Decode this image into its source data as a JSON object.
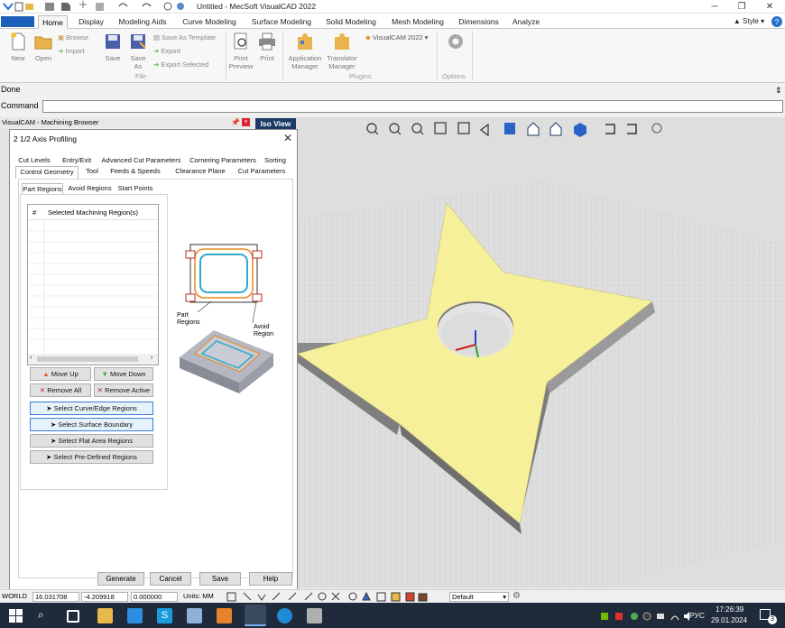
{
  "window": {
    "title": "Untitled - MecSoft VisualCAD 2022"
  },
  "ribbon_tabs": [
    "Home",
    "Display",
    "Modeling Aids",
    "Curve Modeling",
    "Surface Modeling",
    "Solid Modeling",
    "Mesh Modeling",
    "Dimensions",
    "Analyze"
  ],
  "style_label": "Style",
  "ribbon": {
    "new": "New",
    "open": "Open",
    "browse": "Browse",
    "import": "Import",
    "save": "Save",
    "save_as_1": "Save",
    "save_as_2": "As",
    "save_as_template": "Save As Template",
    "export": "Export",
    "export_selected": "Export Selected",
    "file_group": "File",
    "print_preview_1": "Print",
    "print_preview_2": "Preview",
    "print": "Print",
    "app_manager_1": "Application",
    "app_manager_2": "Manager",
    "translator_manager_1": "Translator",
    "translator_manager_2": "Manager",
    "visualcam": "VisualCAM 2022",
    "plugins_group": "Plugins",
    "options_group": "Options"
  },
  "status": {
    "message": "Done",
    "command_label": "Command"
  },
  "browser": {
    "title": "VisualCAM - Machining Browser"
  },
  "viewport": {
    "label": "Iso View"
  },
  "dialog": {
    "title": "2 1/2 Axis Profiling",
    "tabs_row1": [
      "Cut Levels",
      "Entry/Exit",
      "Advanced Cut Parameters",
      "Cornering Parameters",
      "Sorting"
    ],
    "tabs_row2": [
      "Control Geometry",
      "Tool",
      "Feeds & Speeds",
      "Clearance Plane",
      "Cut Parameters"
    ],
    "subtabs": [
      "Part Regions",
      "Avoid Regions",
      "Start Points"
    ],
    "list_headers": [
      "#",
      "Selected Machining Region(s)"
    ],
    "buttons": {
      "move_up": "Move Up",
      "move_down": "Move Down",
      "remove_all": "Remove All",
      "remove_active": "Remove Active",
      "select_curve": "Select Curve/Edge Regions",
      "select_surface": "Select Surface Boundary",
      "select_flat": "Select Flat Area Regions",
      "select_predefined": "Select Pre-Defined Regions"
    },
    "diagram": {
      "part_regions_1": "Part",
      "part_regions_2": "Regions",
      "avoid_region_1": "Avoid",
      "avoid_region_2": "Region"
    },
    "footer": [
      "Generate",
      "Cancel",
      "Save",
      "Help"
    ]
  },
  "bottombar": {
    "world": "WORLD",
    "x": "16.031708",
    "y": "-4.209918",
    "z": "0.000000",
    "units": "Units: MM",
    "layer": "Default"
  },
  "taskbar": {
    "lang": "РУС",
    "time": "17:26:39",
    "date": "29.01.2024",
    "notif_count": "3"
  },
  "colors": {
    "accent": "#1c3a66",
    "star": "#f7f09b",
    "grid_bg": "#dcdcdc"
  }
}
